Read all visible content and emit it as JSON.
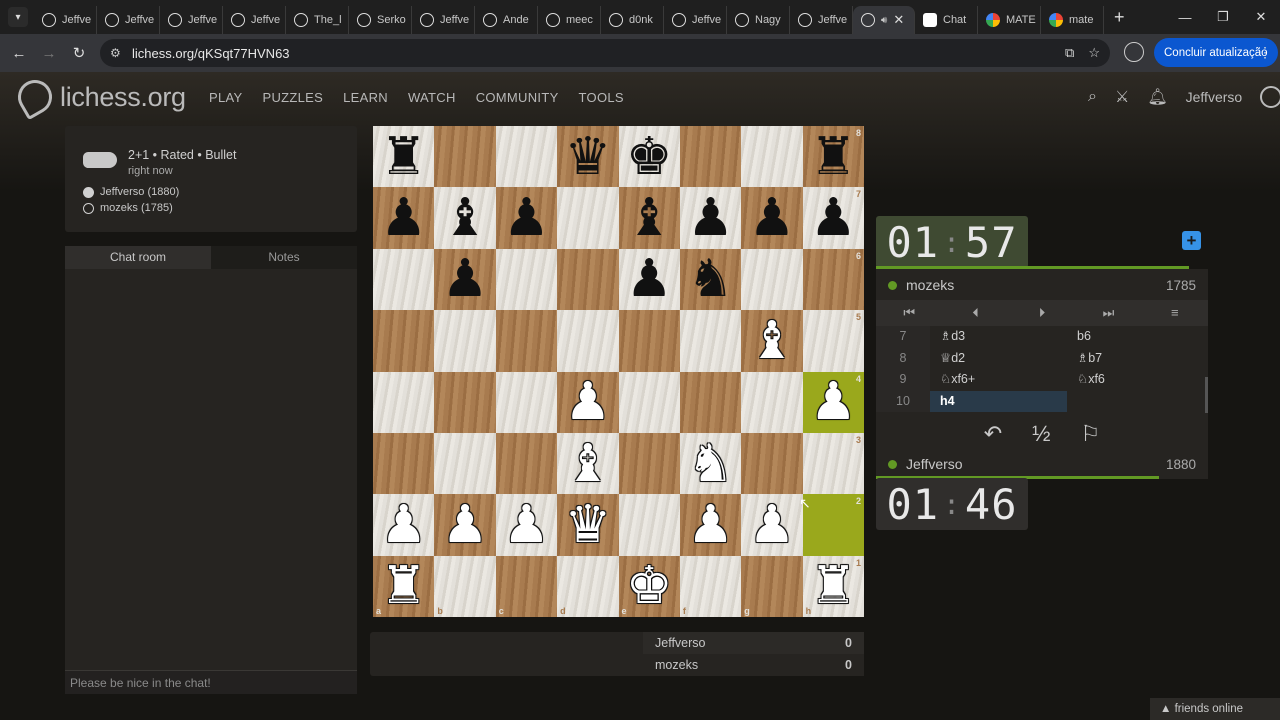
{
  "browser": {
    "tabs": [
      "Jeffve",
      "Jeffve",
      "Jeffve",
      "Jeffve",
      "The_l",
      "Serko",
      "Jeffve",
      "Ande",
      "meec",
      "d0nk",
      "Jeffve",
      "Nagy",
      "Jeffve",
      "",
      "Chat",
      "MATE",
      "mate"
    ],
    "url": "lichess.org/qKSqt77HVN63",
    "update_label": "Concluir atualização"
  },
  "header": {
    "logo_text": "lichess.org",
    "nav": [
      "PLAY",
      "PUZZLES",
      "LEARN",
      "WATCH",
      "COMMUNITY",
      "TOOLS"
    ],
    "username": "Jeffverso"
  },
  "game": {
    "setup": "2+1 • Rated • Bullet",
    "time": "right now",
    "white_player": "Jeffverso (1880)",
    "black_player": "mozeks (1785)"
  },
  "chat": {
    "tabs": [
      "Chat room",
      "Notes"
    ],
    "placeholder": "Please be nice in the chat!"
  },
  "board": {
    "ranks": [
      "8",
      "7",
      "6",
      "5",
      "4",
      "3",
      "2",
      "1"
    ],
    "files": [
      "a",
      "b",
      "c",
      "d",
      "e",
      "f",
      "g",
      "h"
    ],
    "position": [
      [
        "bR",
        "",
        "",
        "bQ",
        "bK",
        "",
        "",
        "bR"
      ],
      [
        "bP",
        "bB",
        "bP",
        "",
        "bB",
        "bP",
        "bP",
        "bP"
      ],
      [
        "",
        "bP",
        "",
        "",
        "bP",
        "bN",
        "",
        ""
      ],
      [
        "",
        "",
        "",
        "",
        "",
        "",
        "wB",
        ""
      ],
      [
        "",
        "",
        "",
        "wP",
        "",
        "",
        "",
        "wP"
      ],
      [
        "",
        "",
        "",
        "wB",
        "",
        "wN",
        "",
        ""
      ],
      [
        "wP",
        "wP",
        "wP",
        "wQ",
        "",
        "wP",
        "wP",
        ""
      ],
      [
        "wR",
        "",
        "",
        "",
        "wK",
        "",
        "",
        "wR"
      ]
    ],
    "highlight_squares": [
      "h4",
      "h2"
    ]
  },
  "material": [
    {
      "name": "Jeffverso",
      "score": "0"
    },
    {
      "name": "mozeks",
      "score": "0"
    }
  ],
  "clocks": {
    "top": {
      "min": "01",
      "sec": "57"
    },
    "bottom": {
      "min": "01",
      "sec": "46"
    }
  },
  "players": {
    "top": {
      "name": "mozeks",
      "rating": "1785"
    },
    "bottom": {
      "name": "Jeffverso",
      "rating": "1880"
    }
  },
  "moves": [
    {
      "no": "7",
      "white": "♗d3",
      "black": "b6"
    },
    {
      "no": "8",
      "white": "♕d2",
      "black": "♗b7"
    },
    {
      "no": "9",
      "white": "♘xf6+",
      "black": "♘xf6"
    },
    {
      "no": "10",
      "white": "h4",
      "black": ""
    }
  ],
  "actions": [
    "↶",
    "½",
    "⚐"
  ],
  "footer": {
    "friends": "▲ friends online"
  }
}
